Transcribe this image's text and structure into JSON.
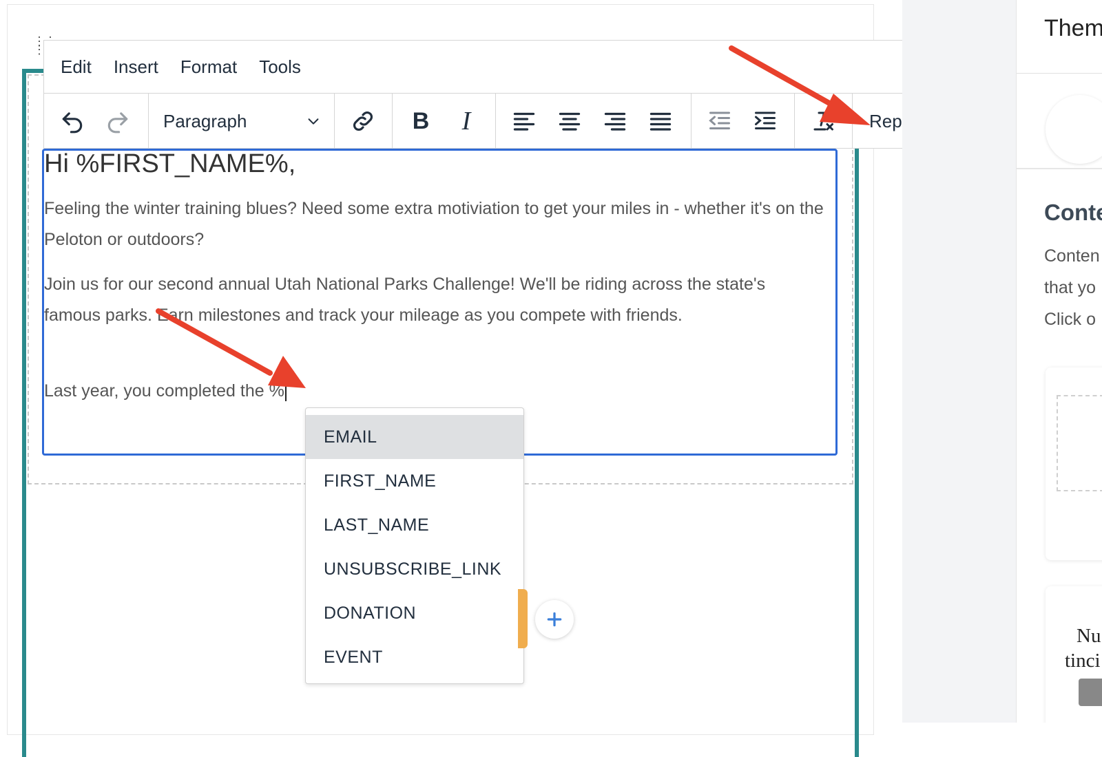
{
  "menubar": {
    "items": [
      "Edit",
      "Insert",
      "Format",
      "Tools"
    ]
  },
  "toolbar": {
    "block_format": "Paragraph",
    "replacement_tags": "Replacement Tags"
  },
  "editor": {
    "greeting": "Hi %FIRST_NAME%,",
    "paragraph1": "Feeling the winter training blues? Need some extra motiviation to get your miles in - whether it's on the Peloton or outdoors?",
    "paragraph2": "Join us for our second annual Utah National Parks Challenge! We'll be riding across the state's famous parks. Earn milestones and track your mileage as you compete with friends.",
    "paragraph3": "Last year, you completed the %"
  },
  "autocomplete": {
    "items": [
      "EMAIL",
      "FIRST_NAME",
      "LAST_NAME",
      "UNSUBSCRIBE_LINK",
      "DONATION",
      "EVENT"
    ],
    "active_index": 0
  },
  "right_panel": {
    "title": "Them",
    "heading": "Conte",
    "lines": [
      "Conten",
      "that yo",
      "Click o"
    ],
    "card_text": [
      "Nu",
      "tinci"
    ]
  },
  "colors": {
    "accent_teal": "#2a8a8c",
    "editor_border": "#2f6ad6",
    "annotation_arrow": "#e8412c",
    "add_tab": "#f0ad4e"
  },
  "icons": [
    "grid-handle-icon",
    "undo-icon",
    "redo-icon",
    "chevron-down-icon",
    "link-icon",
    "bold-icon",
    "italic-icon",
    "align-left-icon",
    "align-center-icon",
    "align-right-icon",
    "align-justify-icon",
    "outdent-icon",
    "indent-icon",
    "clear-formatting-icon",
    "plus-icon",
    "arrow-annotation-icon"
  ]
}
